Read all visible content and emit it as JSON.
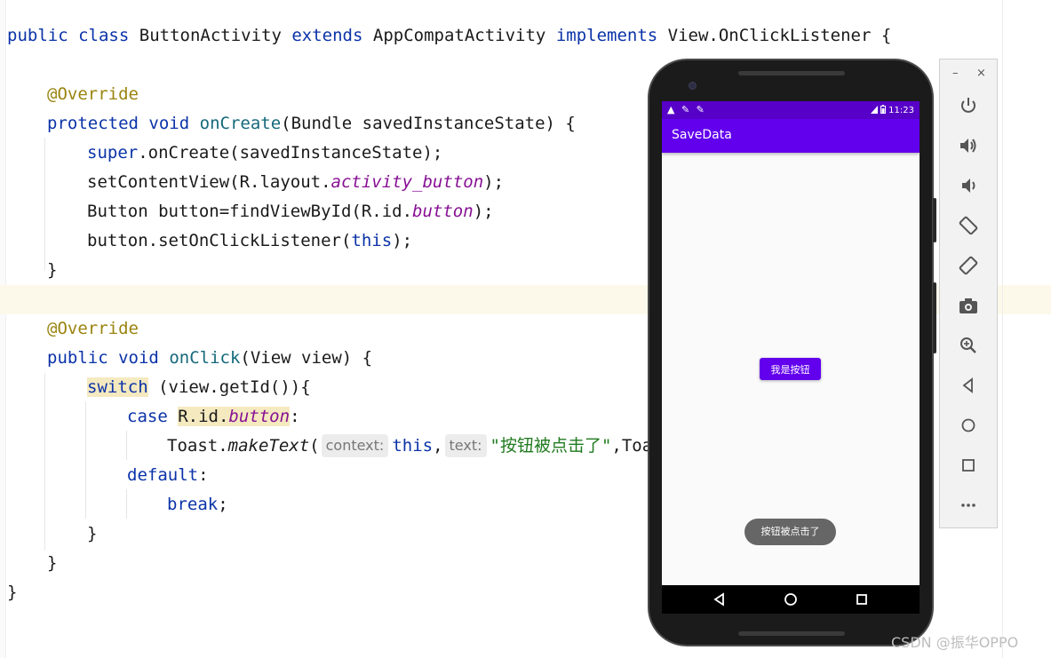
{
  "editor": {
    "lines": {
      "l1": {
        "kw1": "public",
        "kw2": "class",
        "name": "ButtonActivity",
        "kw3": "extends",
        "super": "AppCompatActivity",
        "kw4": "implements",
        "iface": "View.OnClickListener",
        "brace": "{"
      },
      "l2": {
        "ann": "@Override"
      },
      "l3": {
        "kw1": "protected",
        "kw2": "void",
        "fn": "onCreate",
        "rest": "(Bundle savedInstanceState) {"
      },
      "l4": {
        "kw": "super",
        "rest": ".onCreate(savedInstanceState);"
      },
      "l5": {
        "pre": "setContentView(R.layout.",
        "it": "activity_button",
        "post": ");"
      },
      "l6": {
        "pre": "Button button=findViewById(R.id.",
        "it": "button",
        "post": ");"
      },
      "l7": {
        "pre": "button.setOnClickListener(",
        "kw": "this",
        "post": ");"
      },
      "l8": {
        "text": "}"
      },
      "l9": {
        "ann": "@Override"
      },
      "l10": {
        "kw1": "public",
        "kw2": "void",
        "fn": "onClick",
        "rest": "(View view) {"
      },
      "l11": {
        "kw": "switch",
        "rest": " (view.getId()){"
      },
      "l12": {
        "kw": "case",
        "hl_pre": "R.id.",
        "hl_it": "button",
        "post": ":"
      },
      "l13": {
        "pre": "Toast.",
        "im": "makeText",
        "open": "(",
        "hint1": "context:",
        "kw": "this",
        "comma": ",",
        "hint2": "text:",
        "str": "\"按钮被点击了\"",
        "post": ",Toast"
      },
      "l14": {
        "kw": "default",
        "post": ":"
      },
      "l15": {
        "kw": "break",
        "post": ";"
      },
      "l16": {
        "text": "}"
      },
      "l17": {
        "text": "}"
      },
      "l18": {
        "text": "}"
      }
    }
  },
  "emulator": {
    "statusbar": {
      "icons": "▲ ✎ ✎",
      "time": "11:23"
    },
    "app_title": "SaveData",
    "button_label": "我是按钮",
    "toast_text": "按钮被点击了",
    "toolbar": {
      "minimize": "–",
      "close": "×"
    }
  },
  "watermark": "CSDN @振华OPPO",
  "colors": {
    "primary": "#6200ee",
    "status": "#5700c8",
    "toast": "#666666"
  }
}
